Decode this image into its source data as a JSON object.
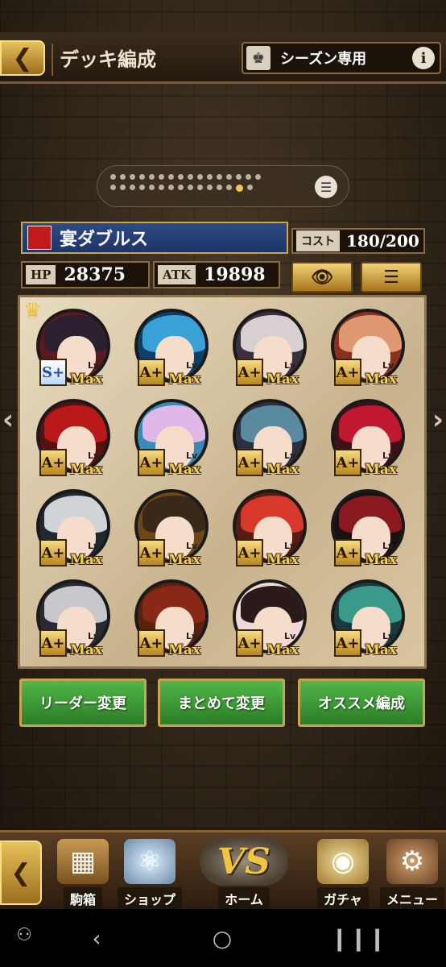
{
  "header": {
    "title": "デッキ編成",
    "season_label": "シーズン専用",
    "info_icon": "i"
  },
  "pager": {
    "total_dots_row1": 16,
    "total_dots_row2": 15,
    "active_index": 13
  },
  "deck": {
    "name": "宴ダブルス",
    "cost_label": "コスト",
    "cost_value": "180/200",
    "hp_label": "HP",
    "hp_value": "28375",
    "atk_label": "ATK",
    "atk_value": "19898"
  },
  "card_common": {
    "lv": "Lv.",
    "max": "Max"
  },
  "cards": [
    {
      "rank": "S+",
      "hair": "#2a2030",
      "bg": "#5a1a20",
      "leader": true
    },
    {
      "rank": "A+",
      "hair": "#3aa0d8",
      "bg": "#0e3e6a"
    },
    {
      "rank": "A+",
      "hair": "#d8d0d0",
      "bg": "#3a3040"
    },
    {
      "rank": "A+",
      "hair": "#e09870",
      "bg": "#8a3020"
    },
    {
      "rank": "A+",
      "hair": "#b81818",
      "bg": "#5a1010"
    },
    {
      "rank": "A+",
      "hair": "#e0b8e8",
      "bg": "#3a8ab8"
    },
    {
      "rank": "A+",
      "hair": "#5a8aa0",
      "bg": "#2a3040"
    },
    {
      "rank": "A+",
      "hair": "#c01830",
      "bg": "#401018"
    },
    {
      "rank": "A+",
      "hair": "#d0d4d8",
      "bg": "#202830"
    },
    {
      "rank": "A+",
      "hair": "#3a2818",
      "bg": "#6a4818"
    },
    {
      "rank": "A+",
      "hair": "#d8382a",
      "bg": "#5a1a14"
    },
    {
      "rank": "A+",
      "hair": "#8a1820",
      "bg": "#1a1010"
    },
    {
      "rank": "A+",
      "hair": "#c8c8cc",
      "bg": "#2a2a34"
    },
    {
      "rank": "A+",
      "hair": "#8a2818",
      "bg": "#5a2010"
    },
    {
      "rank": "A+",
      "hair": "#2a1a1a",
      "bg": "#f0d8d8"
    },
    {
      "rank": "A+",
      "hair": "#3a9a8a",
      "bg": "#1a3a40"
    }
  ],
  "actions": {
    "leader_change": "リーダー変更",
    "bulk_change": "まとめて変更",
    "recommend": "オススメ編成"
  },
  "nav": {
    "pieces": "駒箱",
    "shop": "ショップ",
    "vs": "VS",
    "home": "ホーム",
    "gacha": "ガチャ",
    "menu": "メニュー"
  }
}
